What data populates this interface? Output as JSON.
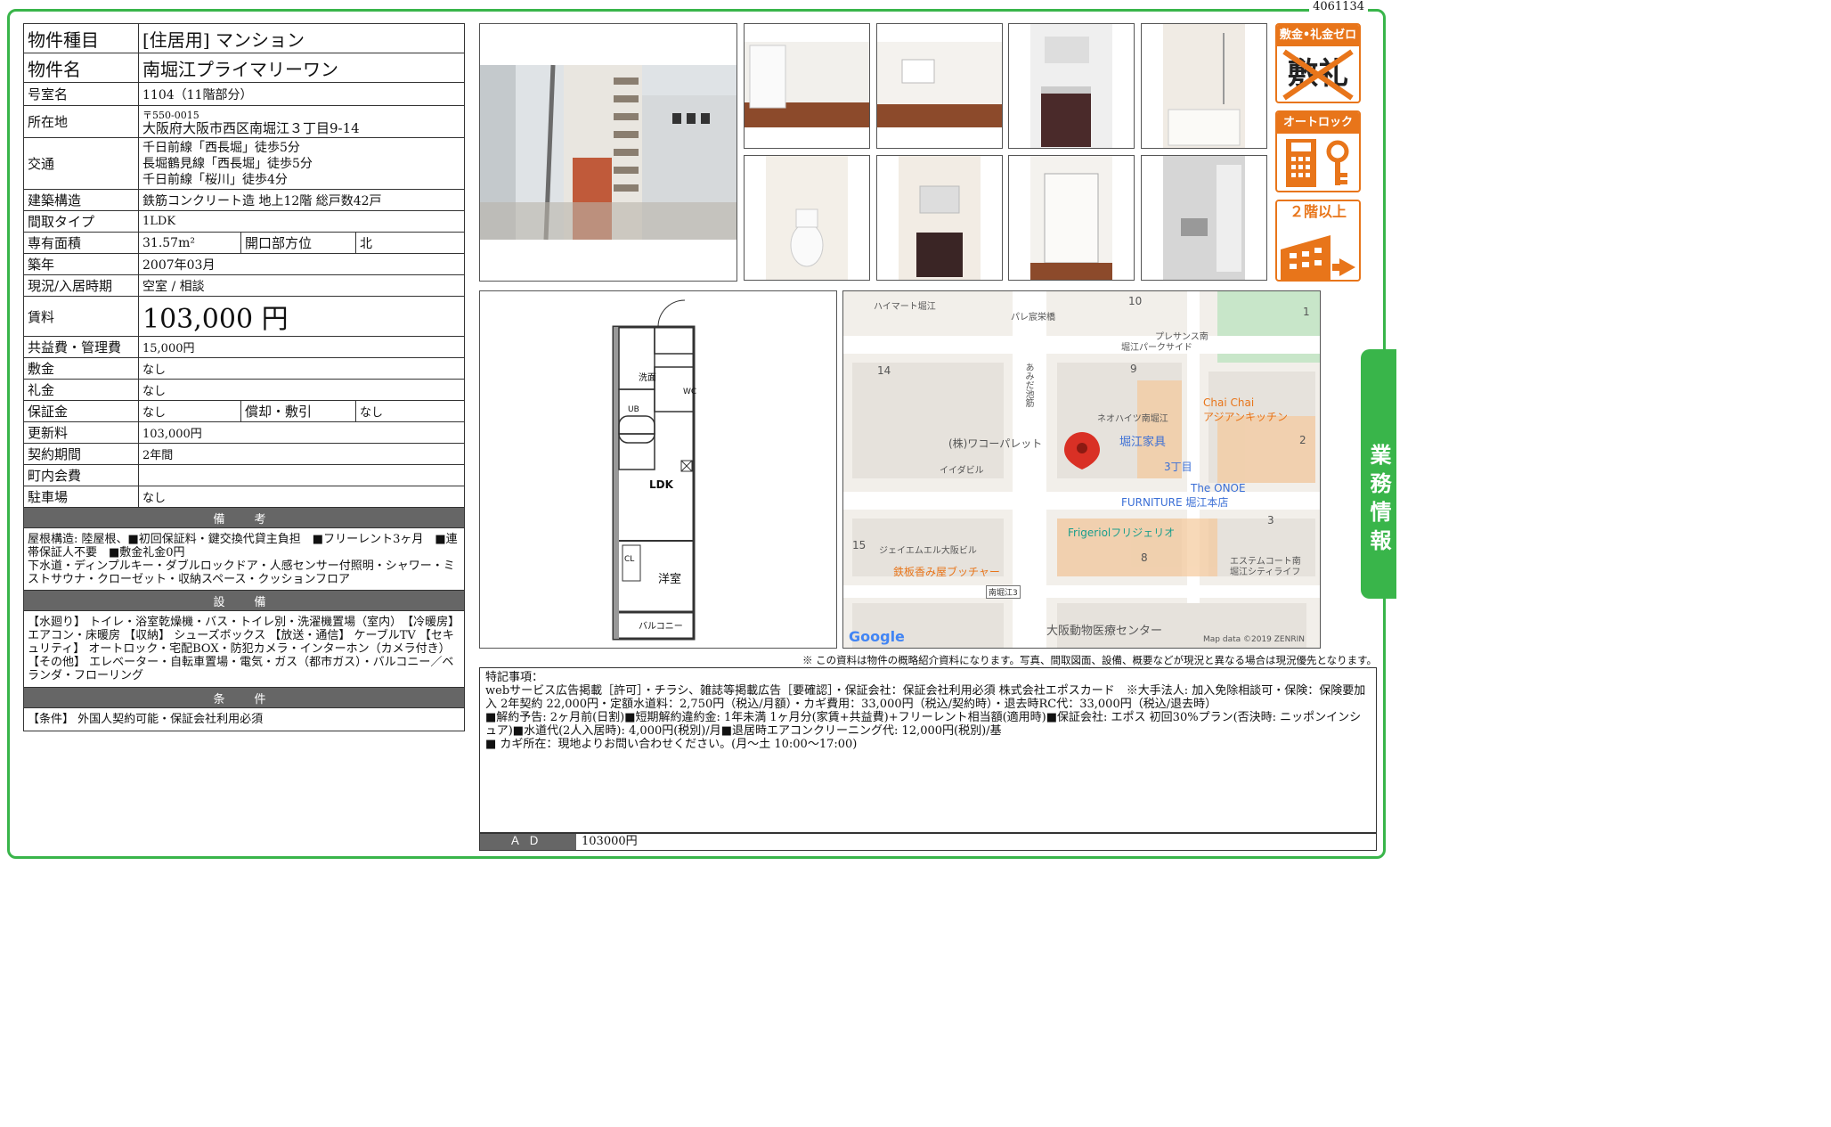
{
  "doc_id": "4061134",
  "side_tab": "業務情報",
  "rows": {
    "type_label": "物件種目",
    "type_value": "[住居用] マンション",
    "name_label": "物件名",
    "name_value": "南堀江プライマリーワン",
    "room_label": "号室名",
    "room_value": "1104（11階部分）",
    "address_label": "所在地",
    "postal": "〒550-0015",
    "address": "大阪府大阪市西区南堀江３丁目9-14",
    "traffic_label": "交通",
    "traffic_1": "千日前線「西長堀」徒歩5分",
    "traffic_2": "長堀鶴見線「西長堀」徒歩5分",
    "traffic_3": "千日前線「桜川」徒歩4分",
    "structure_label": "建築構造",
    "structure_value": "鉄筋コンクリート造 地上12階 総戸数42戸",
    "layout_label": "間取タイプ",
    "layout_value": "1LDK",
    "area_label": "専有面積",
    "area_value": "31.57m²",
    "direction_label": "開口部方位",
    "direction_value": "北",
    "built_label": "築年",
    "built_value": "2007年03月",
    "status_label": "現況/入居時期",
    "status_value": "空室 / 相談",
    "rent_label": "賃料",
    "rent_value": "103,000 円",
    "fee_label": "共益費・管理費",
    "fee_value": "15,000円",
    "deposit_label": "敷金",
    "deposit_value": "なし",
    "key_money_label": "礼金",
    "key_money_value": "なし",
    "guarantee_label": "保証金",
    "guarantee_value": "なし",
    "amort_label": "償却・敷引",
    "amort_value": "なし",
    "renewal_label": "更新料",
    "renewal_value": "103,000円",
    "contract_label": "契約期間",
    "contract_value": "2年間",
    "town_fee_label": "町内会費",
    "town_fee_value": "",
    "parking_label": "駐車場",
    "parking_value": "なし"
  },
  "sections": {
    "remarks_head": "備　考",
    "remarks_body": "屋根構造: 陸屋根、■初回保証料・鍵交換代貸主負担　■フリーレント3ヶ月　■連帯保証人不要　■敷金礼金0円",
    "remarks_body2": "下水道・ディンプルキー・ダブルロックドア・人感センサー付照明・シャワー・ミストサウナ・クローゼット・収納スペース・クッションフロア",
    "equip_head": "設　備",
    "equip_body": "【水廻り】 トイレ・浴室乾燥機・バス・トイレ別・洗濯機置場（室内）　【冷暖房】 エアコン・床暖房 【収納】 シューズボックス 【放送・通信】 ケーブルTV 【セキュリティ】 オートロック・宅配BOX・防犯カメラ・インターホン（カメラ付き） 【その他】 エレベーター・自転車置場・電気・ガス（都市ガス）・バルコニー／ベランダ・フローリング",
    "cond_head": "条　件",
    "cond_body": "【条件】 外国人契約可能・保証会社利用必須"
  },
  "badges": {
    "b1_title": "敷金•礼金ゼロ",
    "b1_sub": "敷礼",
    "b2_title": "オートロック",
    "b3_title": "２階以上"
  },
  "floorplan": {
    "ldk": "LDK",
    "western": "洋室",
    "balcony": "バルコニー",
    "wash": "洗面",
    "ub": "UB",
    "wc": "WC",
    "cl": "CL"
  },
  "map": {
    "labels": [
      "ハイマート堀江",
      "パレ宸栄橋",
      "プレサンス南",
      "堀江パークサイド",
      "ネオハイツ南堀江",
      "Chai Chai",
      "アジアンキッチン",
      "(株)ワコーパレット",
      "堀江家具",
      "3丁目",
      "イイダビル",
      "The ONOE",
      "FURNITURE 堀江本店",
      "Frigeriolフリジェリオ",
      "ジェイエムエル大阪ビル",
      "鉄板香み屋ブッチャー",
      "南堀江3",
      "エステムコート南",
      "堀江シティライフ",
      "大阪動物医療センター",
      "あみだ池筋",
      "10",
      "1",
      "14",
      "9",
      "2",
      "3",
      "8",
      "15"
    ],
    "google": "Google",
    "attribution": "Map data ©2019 ZENRIN"
  },
  "notice": "※ この資料は物件の概略紹介資料になります。写真、間取図面、設備、概要などが現況と異なる場合は現況優先となります。",
  "special": {
    "heading": "特記事項：",
    "line1": "webサービス広告掲載［許可］・チラシ、雑誌等掲載広告［要確認］・保証会社：保証会社利用必須 株式会社エポスカード　※大手法人: 加入免除相談可・保険：保険要加入 2年契約 22,000円・定額水道料：2,750円（税込/月額）・カギ費用：33,000円（税込/契約時）・退去時RC代：33,000円（税込/退去時）",
    "line2": "■解約予告: 2ヶ月前(日割)■短期解約違約金: 1年未満 1ヶ月分(家賃+共益費)+フリーレント相当額(適用時)■保証会社: エポス 初回30%プラン(否決時: ニッポンインシュア)■水道代(2人入居時): 4,000円(税別)/月■退居時エアコンクリーニング代: 12,000円(税別)/基",
    "line3": "■ カギ所在：現地よりお問い合わせください。(月〜土 10:00〜17:00)"
  },
  "ad": {
    "label": "ＡＤ",
    "value": "103000円"
  },
  "colors": {
    "frame": "#39b54a",
    "badge": "#e8751a",
    "section_head": "#666666",
    "map_pin": "#d93025"
  }
}
